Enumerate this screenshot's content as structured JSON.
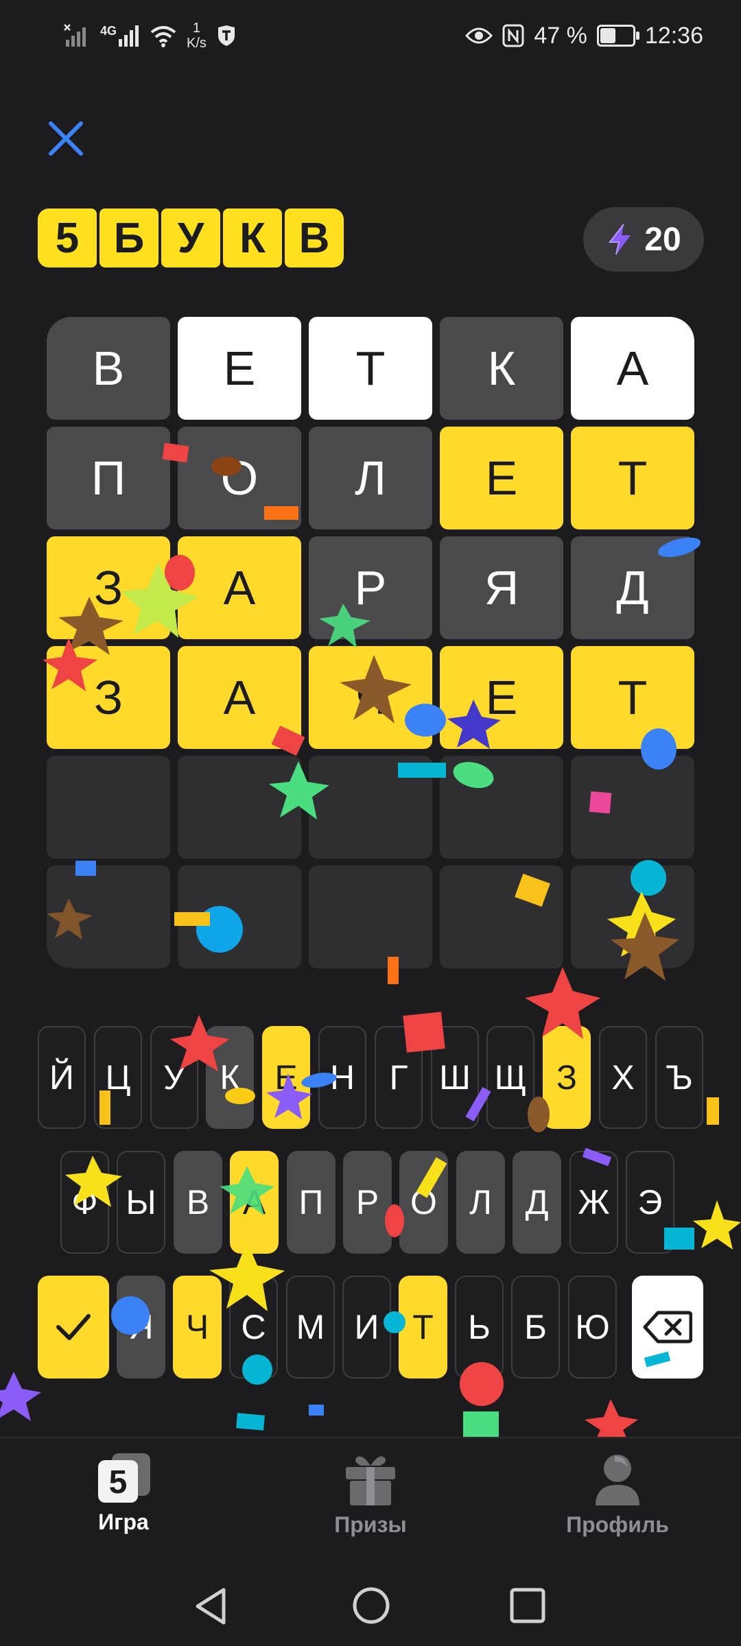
{
  "status_bar": {
    "network_type": "4G",
    "speed_value": "1",
    "speed_unit": "K/s",
    "battery": "47 %",
    "battery_level": 0.47,
    "time": "12:36"
  },
  "game": {
    "logo_letters": [
      "5",
      "Б",
      "У",
      "К",
      "В"
    ],
    "energy": "20",
    "board": [
      [
        {
          "l": "В",
          "s": "absent"
        },
        {
          "l": "Е",
          "s": "present"
        },
        {
          "l": "Т",
          "s": "present"
        },
        {
          "l": "К",
          "s": "absent"
        },
        {
          "l": "А",
          "s": "present"
        }
      ],
      [
        {
          "l": "П",
          "s": "absent"
        },
        {
          "l": "О",
          "s": "absent"
        },
        {
          "l": "Л",
          "s": "absent"
        },
        {
          "l": "Е",
          "s": "correct"
        },
        {
          "l": "Т",
          "s": "correct"
        }
      ],
      [
        {
          "l": "З",
          "s": "correct"
        },
        {
          "l": "А",
          "s": "correct"
        },
        {
          "l": "Р",
          "s": "absent"
        },
        {
          "l": "Я",
          "s": "absent"
        },
        {
          "l": "Д",
          "s": "absent"
        }
      ],
      [
        {
          "l": "З",
          "s": "correct"
        },
        {
          "l": "А",
          "s": "correct"
        },
        {
          "l": "Ч",
          "s": "correct"
        },
        {
          "l": "Е",
          "s": "correct"
        },
        {
          "l": "Т",
          "s": "correct"
        }
      ],
      [
        {
          "l": "",
          "s": "empty"
        },
        {
          "l": "",
          "s": "empty"
        },
        {
          "l": "",
          "s": "empty"
        },
        {
          "l": "",
          "s": "empty"
        },
        {
          "l": "",
          "s": "empty"
        }
      ],
      [
        {
          "l": "",
          "s": "empty"
        },
        {
          "l": "",
          "s": "empty"
        },
        {
          "l": "",
          "s": "empty"
        },
        {
          "l": "",
          "s": "empty"
        },
        {
          "l": "",
          "s": "empty"
        }
      ]
    ]
  },
  "keyboard": {
    "rows": [
      [
        {
          "k": "Й",
          "s": "unused"
        },
        {
          "k": "Ц",
          "s": "unused"
        },
        {
          "k": "У",
          "s": "unused"
        },
        {
          "k": "К",
          "s": "absent"
        },
        {
          "k": "Е",
          "s": "correct"
        },
        {
          "k": "Н",
          "s": "unused"
        },
        {
          "k": "Г",
          "s": "unused"
        },
        {
          "k": "Ш",
          "s": "unused"
        },
        {
          "k": "Щ",
          "s": "unused"
        },
        {
          "k": "З",
          "s": "correct"
        },
        {
          "k": "Х",
          "s": "unused"
        },
        {
          "k": "Ъ",
          "s": "unused"
        }
      ],
      [
        {
          "k": "Ф",
          "s": "unused"
        },
        {
          "k": "Ы",
          "s": "unused"
        },
        {
          "k": "В",
          "s": "absent"
        },
        {
          "k": "А",
          "s": "correct"
        },
        {
          "k": "П",
          "s": "absent"
        },
        {
          "k": "Р",
          "s": "absent"
        },
        {
          "k": "О",
          "s": "absent"
        },
        {
          "k": "Л",
          "s": "absent"
        },
        {
          "k": "Д",
          "s": "absent"
        },
        {
          "k": "Ж",
          "s": "unused"
        },
        {
          "k": "Э",
          "s": "unused"
        }
      ],
      [
        {
          "k": "Я",
          "s": "absent"
        },
        {
          "k": "Ч",
          "s": "correct"
        },
        {
          "k": "С",
          "s": "unused"
        },
        {
          "k": "М",
          "s": "unused"
        },
        {
          "k": "И",
          "s": "unused"
        },
        {
          "k": "Т",
          "s": "correct"
        },
        {
          "k": "Ь",
          "s": "unused"
        },
        {
          "k": "Б",
          "s": "unused"
        },
        {
          "k": "Ю",
          "s": "unused"
        }
      ]
    ]
  },
  "bottom_nav": {
    "items": [
      {
        "label": "Игра",
        "icon": "game-5-icon",
        "active": true
      },
      {
        "label": "Призы",
        "icon": "gift-icon",
        "active": false
      },
      {
        "label": "Профиль",
        "icon": "profile-icon",
        "active": false
      }
    ]
  },
  "colors": {
    "accent": "#ffda2a",
    "background": "#1c1c1e",
    "close_icon": "#3b82f6",
    "energy_icon": "#8b5cf6"
  }
}
